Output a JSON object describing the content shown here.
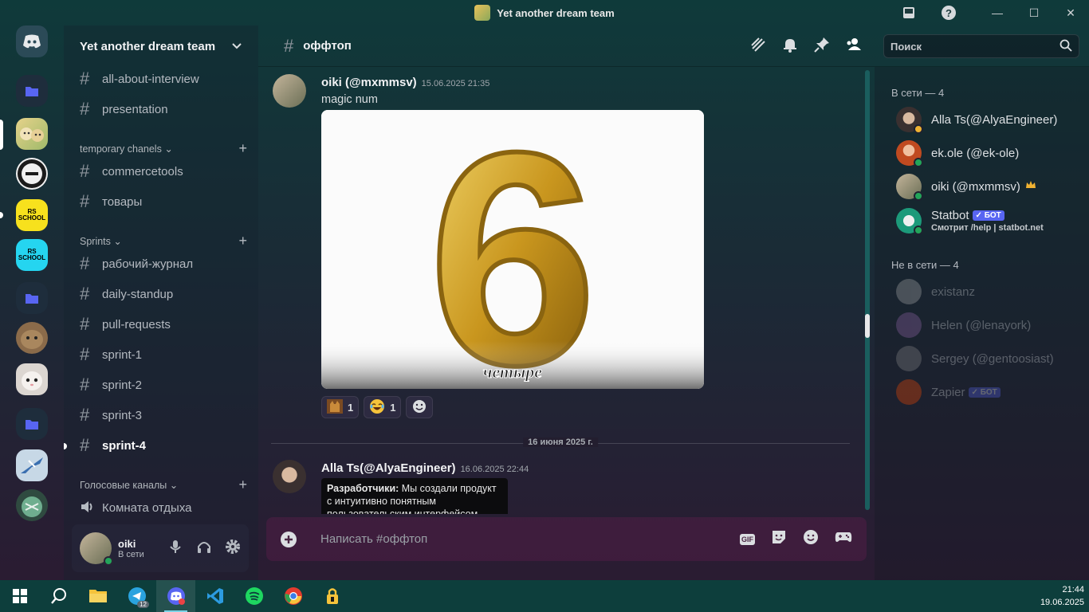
{
  "window": {
    "title": "Yet another dream team",
    "guild_icon": "guild-icon"
  },
  "servers": [
    {
      "name": "discord-home-icon"
    },
    {
      "name": "folder-icon"
    },
    {
      "name": "dogs-server-icon"
    },
    {
      "name": "stack-overflow-server-icon"
    },
    {
      "name": "rs-school-yellow-server-icon",
      "label": "RS SCHOOL"
    },
    {
      "name": "rs-school-cyan-server-icon",
      "label": "RS SCHOOL"
    },
    {
      "name": "folder-icon"
    },
    {
      "name": "cat-server-icon"
    },
    {
      "name": "white-cat-server-icon"
    },
    {
      "name": "folder-icon"
    },
    {
      "name": "airplane-server-icon"
    },
    {
      "name": "monster-server-icon"
    }
  ],
  "guild": {
    "name": "Yet another dream team",
    "channels_top": [
      "all-about-interview",
      "presentation"
    ],
    "categories": [
      {
        "label": "temporary chanels",
        "channels": [
          "commercetools",
          "товары"
        ]
      },
      {
        "label": "Sprints",
        "channels": [
          "рабочий-журнал",
          "daily-standup",
          "pull-requests",
          "sprint-1",
          "sprint-2",
          "sprint-3",
          "sprint-4"
        ]
      },
      {
        "label": "Голосовые каналы",
        "voice": [
          "Комната отдыха"
        ]
      }
    ],
    "active_channel": "sprint-4"
  },
  "user_panel": {
    "name": "oiki",
    "status": "В сети"
  },
  "channel": {
    "name": "оффтоп",
    "search_placeholder": "Поиск"
  },
  "messages": [
    {
      "author": "oiki (@mxmmsv)",
      "timestamp": "15.06.2025 21:35",
      "text": "magic num",
      "image_caption": "четыре",
      "image_number": "6",
      "reactions": [
        {
          "emoji": "cat-reaction-icon",
          "count": "1"
        },
        {
          "emoji": "laughing-face-icon",
          "count": "1"
        }
      ]
    },
    {
      "author": "Alla Ts(@AlyaEngineer)",
      "timestamp": "16.06.2025 22:44",
      "embed_bold": "Разработчики:",
      "embed_text": " Мы создали продукт с интуитивно понятным пользовательским интерфейсом."
    }
  ],
  "date_divider": "16 июня 2025 г.",
  "composer": {
    "placeholder": "Написать #оффтоп",
    "gif": "GIF"
  },
  "members": {
    "online_header": "В сети — 4",
    "offline_header": "Не в сети — 4",
    "online": [
      {
        "name": "Alla Ts(@AlyaEngineer)",
        "status_color": "#f0b232"
      },
      {
        "name": "ek.ole (@ek-ole)",
        "status_color": "#23a55a"
      },
      {
        "name": "oiki (@mxmmsv)",
        "status_color": "#23a55a",
        "crown": "crown-icon"
      },
      {
        "name": "Statbot",
        "bot": "БОТ",
        "sub": "Смотрит /help | statbot.net",
        "status_color": "#23a55a"
      }
    ],
    "offline": [
      {
        "name": "existanz"
      },
      {
        "name": "Helen (@lenayork)"
      },
      {
        "name": "Sergey (@gentoosiast)"
      },
      {
        "name": "Zapier",
        "bot": "БОТ"
      }
    ]
  },
  "taskbar": {
    "time": "21:44",
    "date": "19.06.2025",
    "telegram_badge": "12"
  },
  "colors": {
    "accent": "#5865f2",
    "online": "#23a55a",
    "idle": "#f0b232"
  }
}
